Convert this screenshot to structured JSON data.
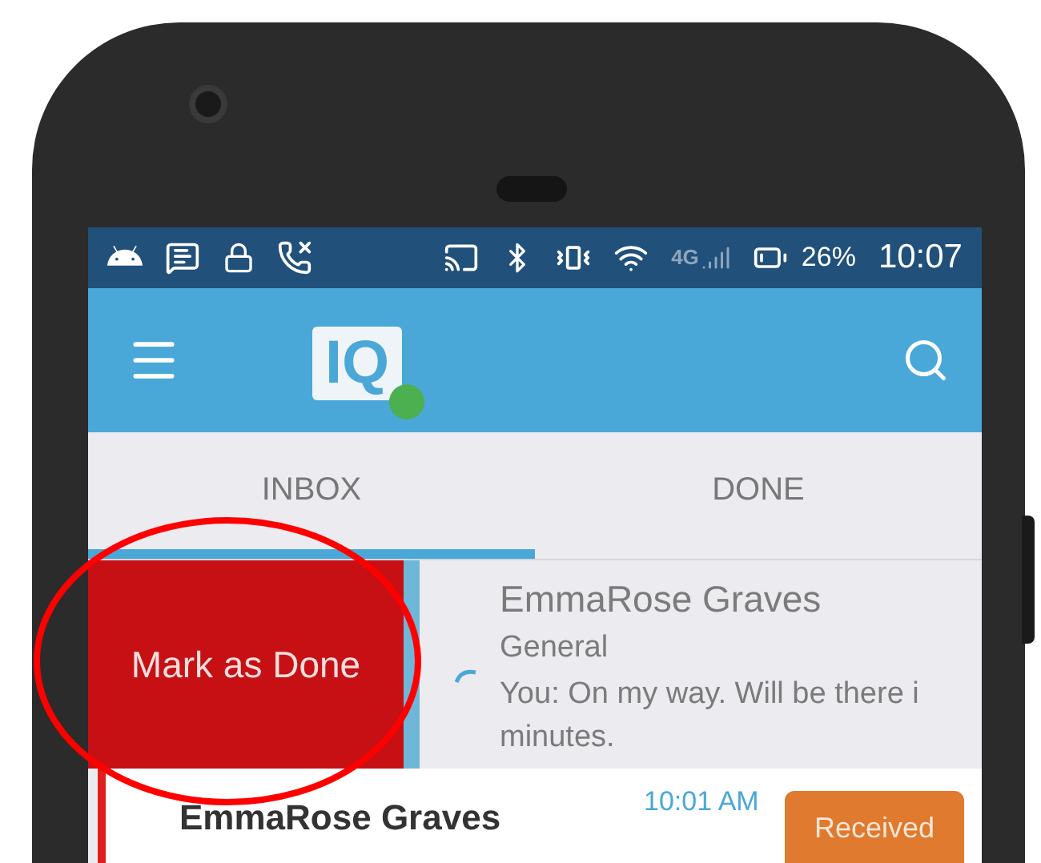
{
  "status_bar": {
    "network": "4G",
    "battery": "26%",
    "time": "10:07"
  },
  "app_bar": {
    "logo_text": "IQ"
  },
  "tabs": [
    {
      "label": "INBOX",
      "selected": true
    },
    {
      "label": "DONE",
      "selected": false
    }
  ],
  "conversations": [
    {
      "kind": "swiped",
      "action": "Mark as Done",
      "name": "EmmaRose Graves",
      "category": "General",
      "preview": "You: On my way. Will be there i",
      "preview_continued": "minutes."
    },
    {
      "kind": "normal",
      "name": "EmmaRose Graves",
      "time": "10:01 AM",
      "status": "Received"
    }
  ]
}
